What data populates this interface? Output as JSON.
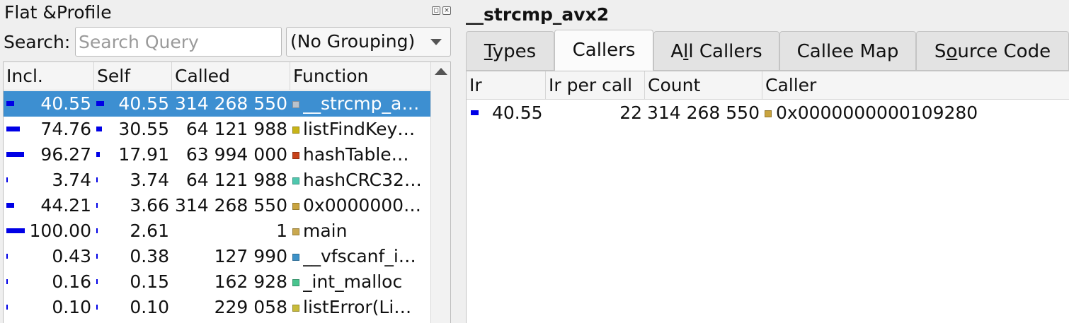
{
  "left_dock": {
    "title": "Flat &Profile",
    "buttons": [
      "restore",
      "close"
    ],
    "search_label": "Search:",
    "search_placeholder": "Search Query",
    "search_value": "",
    "grouping": "(No Grouping)"
  },
  "flat_table": {
    "columns": [
      "Incl.",
      "Self",
      "Called",
      "Function"
    ],
    "rows": [
      {
        "incl": "40.55",
        "self": "40.55",
        "called": "314 268 550",
        "function": "__strcmp_a…",
        "incl_pct": 40.55,
        "self_pct": 40.55,
        "color": "#b9c2cc",
        "selected": true
      },
      {
        "incl": "74.76",
        "self": "30.55",
        "called": "64 121 988",
        "function": "listFindKey…",
        "incl_pct": 74.76,
        "self_pct": 30.55,
        "color": "#c8b418",
        "selected": false
      },
      {
        "incl": "96.27",
        "self": "17.91",
        "called": "63 994 000",
        "function": "hashTable…",
        "incl_pct": 96.27,
        "self_pct": 17.91,
        "color": "#c8421a",
        "selected": false
      },
      {
        "incl": "3.74",
        "self": "3.74",
        "called": "64 121 988",
        "function": "hashCRC32…",
        "incl_pct": 3.74,
        "self_pct": 3.74,
        "color": "#4fc7ae",
        "selected": false
      },
      {
        "incl": "44.21",
        "self": "3.66",
        "called": "314 268 550",
        "function": "0x0000000…",
        "incl_pct": 44.21,
        "self_pct": 3.66,
        "color": "#c9a43f",
        "selected": false
      },
      {
        "incl": "100.00",
        "self": "2.61",
        "called": "1",
        "function": "main",
        "incl_pct": 100.0,
        "self_pct": 2.61,
        "color": "#c9a84f",
        "selected": false
      },
      {
        "incl": "0.43",
        "self": "0.38",
        "called": "127 990",
        "function": "__vfscanf_i…",
        "incl_pct": 0.43,
        "self_pct": 0.38,
        "color": "#3d92c8",
        "selected": false
      },
      {
        "incl": "0.16",
        "self": "0.15",
        "called": "162 928",
        "function": "_int_malloc",
        "incl_pct": 0.16,
        "self_pct": 0.15,
        "color": "#49c48e",
        "selected": false
      },
      {
        "incl": "0.10",
        "self": "0.10",
        "called": "229 058",
        "function": "listError(Li…",
        "incl_pct": 0.1,
        "self_pct": 0.1,
        "color": "#c8bb3a",
        "selected": false
      }
    ]
  },
  "right_panel": {
    "title": "__strcmp_avx2",
    "tabs": [
      {
        "label": "Types",
        "mnemonic": "T",
        "active": false
      },
      {
        "label": "Callers",
        "mnemonic": "",
        "active": true
      },
      {
        "label": "All Callers",
        "mnemonic": "l",
        "active": false
      },
      {
        "label": "Callee Map",
        "mnemonic": "",
        "active": false
      },
      {
        "label": "Source Code",
        "mnemonic": "o",
        "active": false
      }
    ],
    "callers_table": {
      "columns": [
        "Ir",
        "Ir per call",
        "Count",
        "Caller"
      ],
      "rows": [
        {
          "ir": "40.55",
          "ir_per_call": "22",
          "count": "314 268 550",
          "caller": "0x0000000000109280",
          "ir_pct": 40.55,
          "color": "#c9a43f"
        }
      ]
    }
  },
  "colors": {
    "selection": "#3d8fd1",
    "cost_bar": "#0000e6"
  }
}
